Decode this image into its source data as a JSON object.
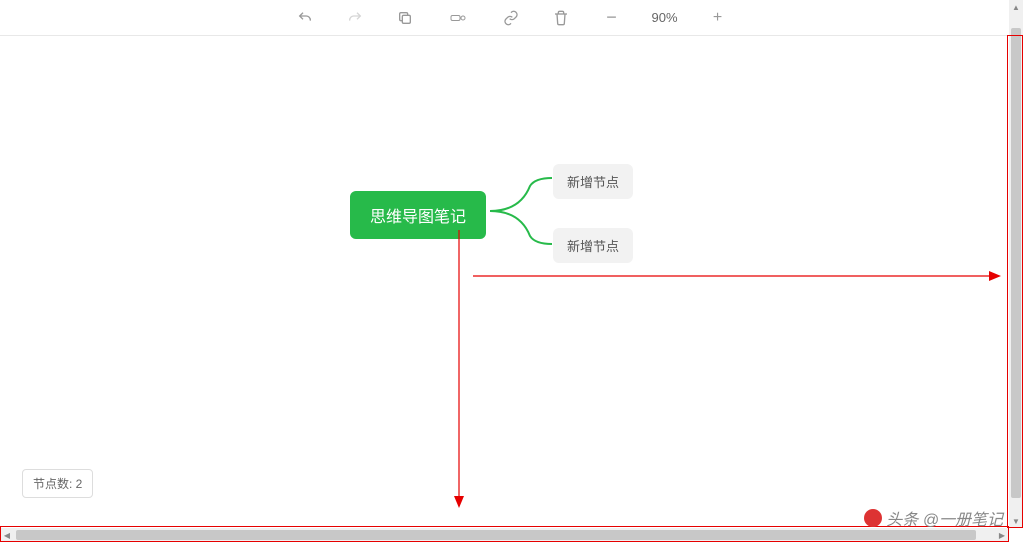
{
  "toolbar": {
    "zoom_level": "90%"
  },
  "mindmap": {
    "root": "思维导图笔记",
    "children": [
      "新增节点",
      "新增节点"
    ]
  },
  "status": {
    "node_count_label": "节点数: 2"
  },
  "watermark": {
    "text": "头条 @一册笔记"
  },
  "colors": {
    "root_bg": "#27ba4a",
    "child_bg": "#f2f2f2",
    "annotation": "#e60000"
  }
}
